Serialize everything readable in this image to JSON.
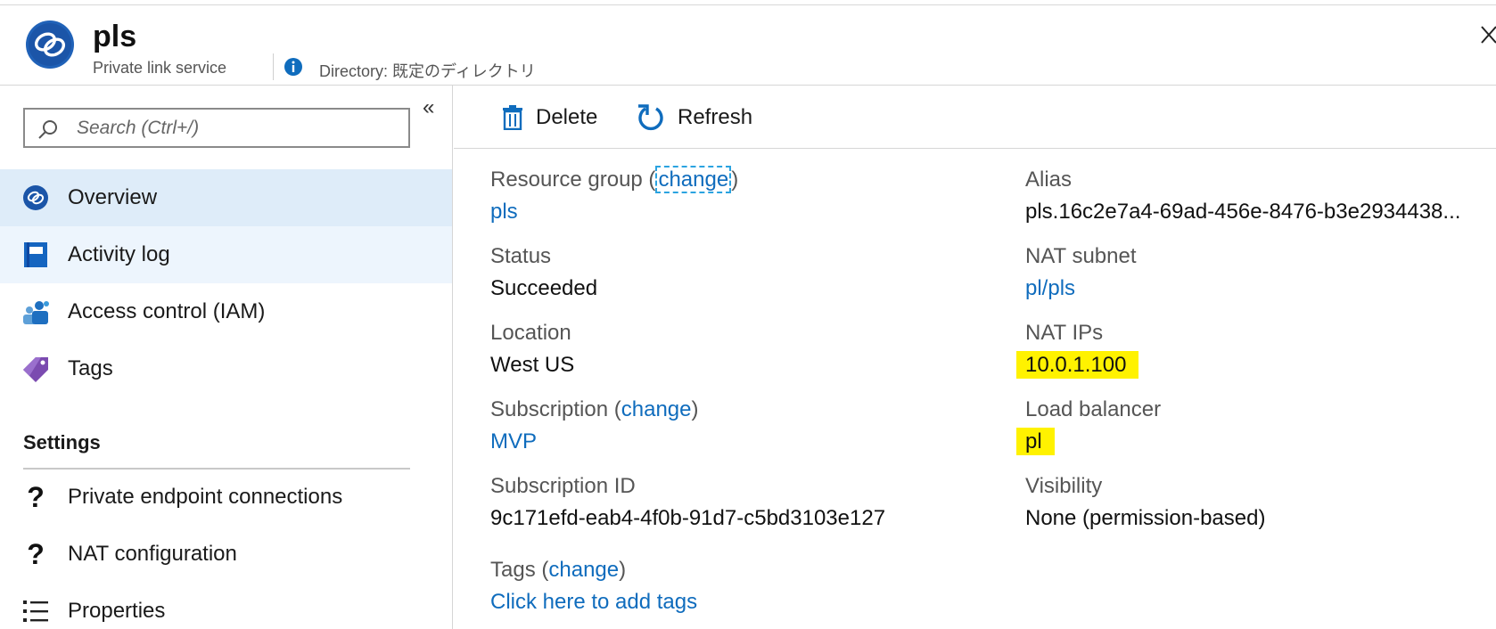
{
  "header": {
    "title": "pls",
    "subtitle": "Private link service",
    "directory": "Directory: 既定のディレクトリ"
  },
  "sidebar": {
    "search_placeholder": "Search (Ctrl+/)",
    "collapse_glyph": "«",
    "items": [
      {
        "label": "Overview",
        "icon": "private-link-icon",
        "state": "selected"
      },
      {
        "label": "Activity log",
        "icon": "activity-log-icon",
        "state": "hover"
      },
      {
        "label": "Access control (IAM)",
        "icon": "iam-icon"
      },
      {
        "label": "Tags",
        "icon": "tag-icon"
      }
    ],
    "settings_heading": "Settings",
    "settings_items": [
      {
        "label": "Private endpoint connections",
        "icon": "question-icon"
      },
      {
        "label": "NAT configuration",
        "icon": "question-icon"
      },
      {
        "label": "Properties",
        "icon": "properties-icon"
      }
    ]
  },
  "toolbar": {
    "delete_label": "Delete",
    "refresh_label": "Refresh"
  },
  "essentials": {
    "left": {
      "resource_group": {
        "label": "Resource group",
        "change": "change",
        "value": "pls"
      },
      "status": {
        "label": "Status",
        "value": "Succeeded"
      },
      "location": {
        "label": "Location",
        "value": "West US"
      },
      "subscription": {
        "label": "Subscription",
        "change": "change",
        "value": "MVP"
      },
      "subscription_id": {
        "label": "Subscription ID",
        "value": "9c171efd-eab4-4f0b-91d7-c5bd3103e127"
      },
      "tags": {
        "label": "Tags",
        "change": "change",
        "value": "Click here to add tags"
      }
    },
    "right": {
      "alias": {
        "label": "Alias",
        "value": "pls.16c2e7a4-69ad-456e-8476-b3e2934438..."
      },
      "nat_subnet": {
        "label": "NAT subnet",
        "value": "pl/pls"
      },
      "nat_ips": {
        "label": "NAT IPs",
        "value": "10.0.1.100"
      },
      "load_balancer": {
        "label": "Load balancer",
        "value": "pl"
      },
      "visibility": {
        "label": "Visibility",
        "value": "None (permission-based)"
      }
    }
  },
  "colors": {
    "link": "#0f6cbd",
    "selected_bg": "#deecf9",
    "highlight": "#fff200"
  }
}
